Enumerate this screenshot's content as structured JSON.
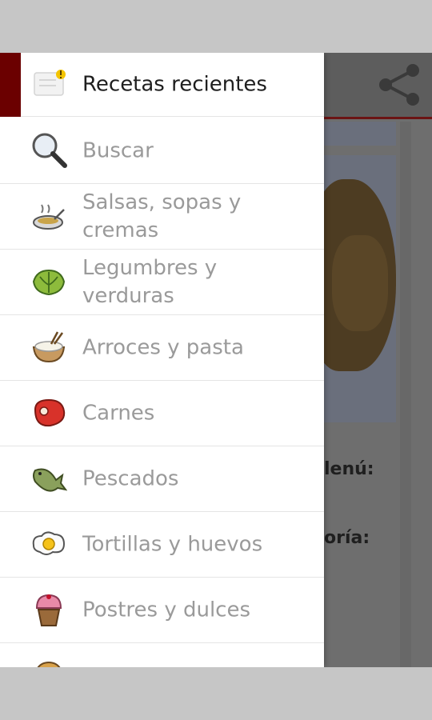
{
  "background": {
    "labels": [
      "lenú:",
      "oría:"
    ]
  },
  "drawer": {
    "items": [
      {
        "label": "Recetas recientes",
        "icon": "recent-recipes-icon"
      },
      {
        "label": "Buscar",
        "icon": "magnifier-icon"
      },
      {
        "label": "Salsas, sopas y cremas",
        "icon": "soup-icon"
      },
      {
        "label": "Legumbres y verduras",
        "icon": "lettuce-icon"
      },
      {
        "label": "Arroces y pasta",
        "icon": "rice-bowl-icon"
      },
      {
        "label": "Carnes",
        "icon": "meat-icon"
      },
      {
        "label": "Pescados",
        "icon": "fish-icon"
      },
      {
        "label": "Tortillas y huevos",
        "icon": "egg-icon"
      },
      {
        "label": "Postres y dulces",
        "icon": "cupcake-icon"
      }
    ]
  },
  "colors": {
    "accent": "#6b0000",
    "drawer_bg": "#ffffff",
    "item_text": "#9a9a9a",
    "header_text": "#1e1e1e"
  }
}
